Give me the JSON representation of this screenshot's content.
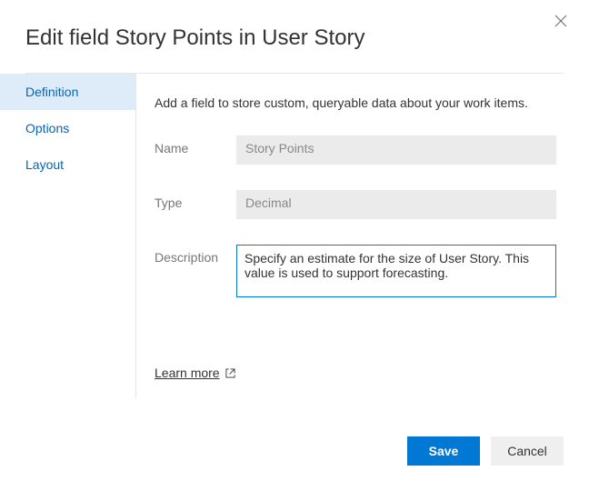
{
  "header": {
    "title": "Edit field Story Points in User Story"
  },
  "sidebar": {
    "items": [
      {
        "label": "Definition",
        "active": true
      },
      {
        "label": "Options",
        "active": false
      },
      {
        "label": "Layout",
        "active": false
      }
    ]
  },
  "main": {
    "intro": "Add a field to store custom, queryable data about your work items.",
    "labels": {
      "name": "Name",
      "type": "Type",
      "description": "Description"
    },
    "values": {
      "name": "Story Points",
      "type": "Decimal",
      "description": "Specify an estimate for the size of User Story. This value is used to support forecasting."
    },
    "learn_more": "Learn more"
  },
  "footer": {
    "save": "Save",
    "cancel": "Cancel"
  }
}
